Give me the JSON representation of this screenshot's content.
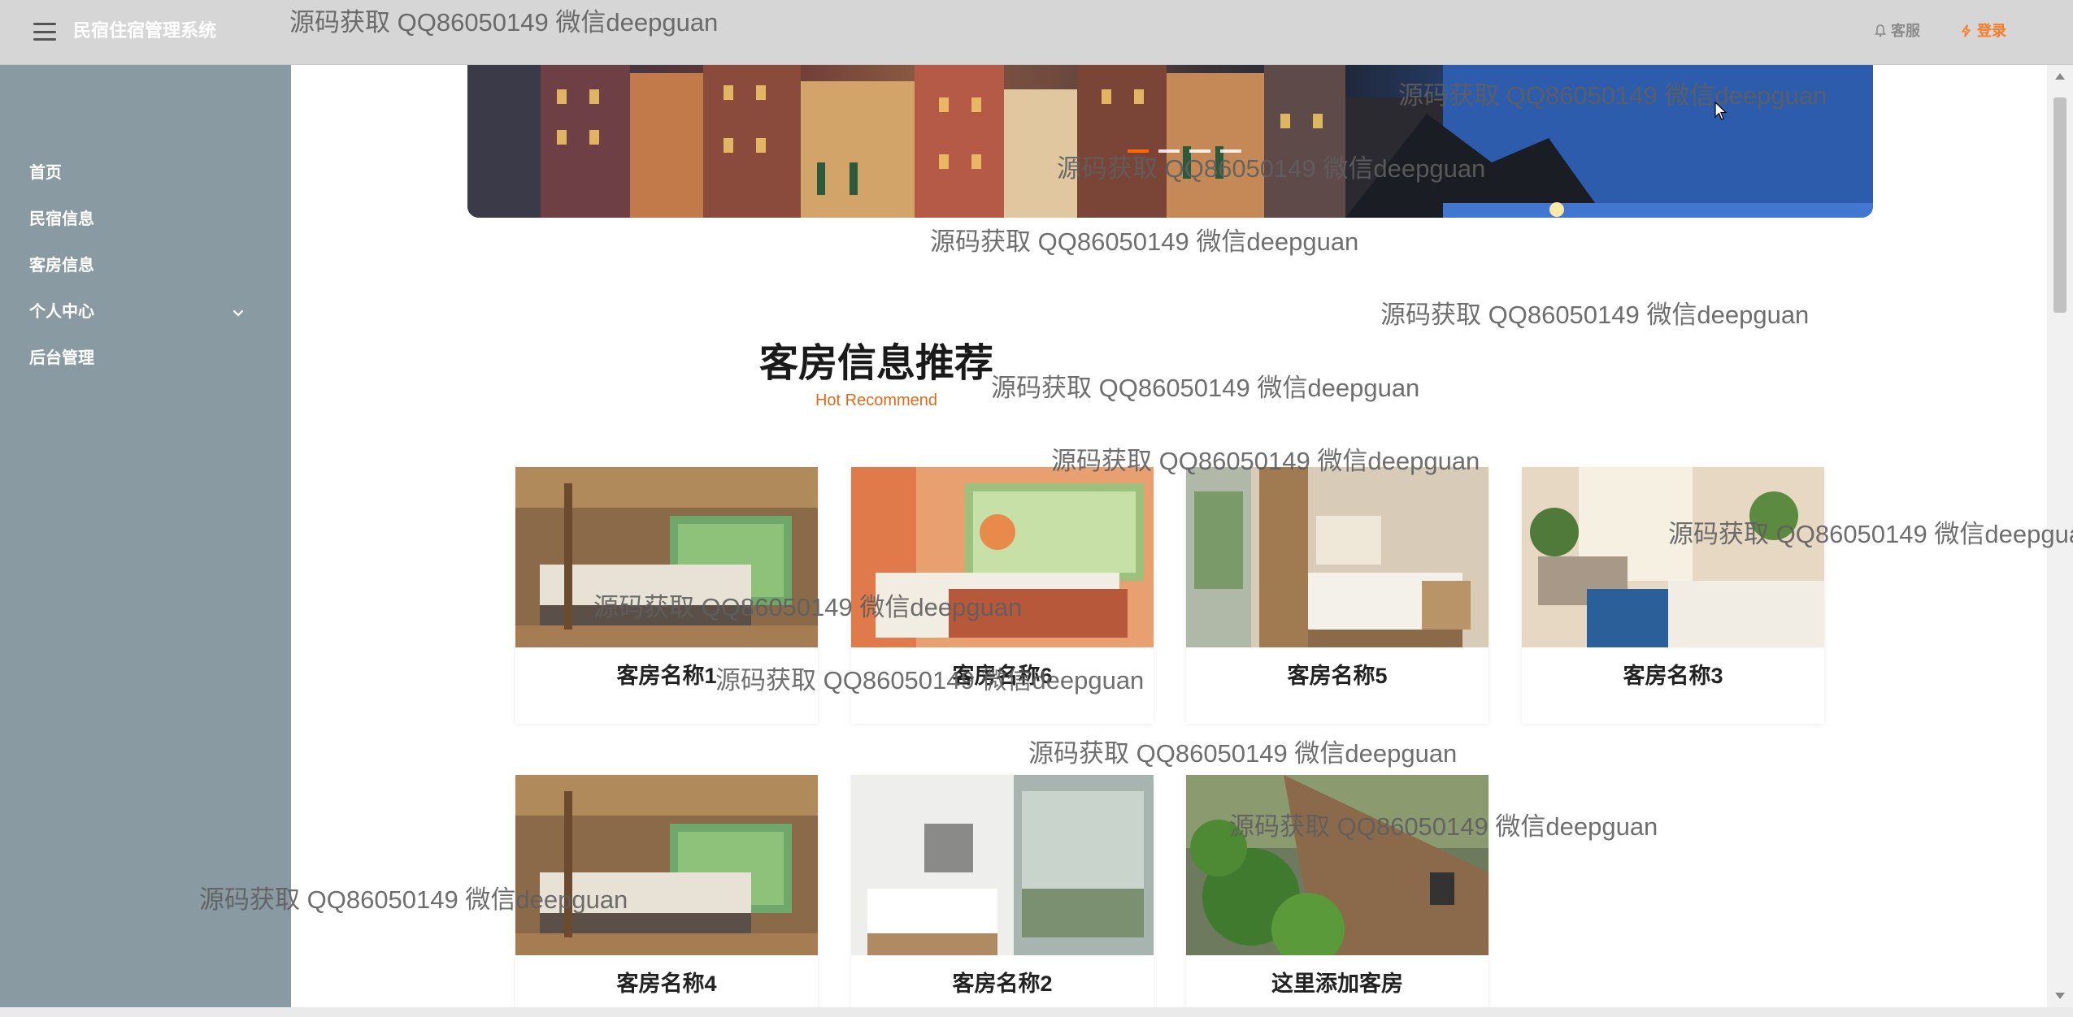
{
  "header": {
    "app_title": "民宿住宿管理系统",
    "service_label": "客服",
    "login_label": "登录"
  },
  "sidebar": {
    "items": [
      {
        "label": "首页"
      },
      {
        "label": "民宿信息"
      },
      {
        "label": "客房信息"
      },
      {
        "label": "个人中心"
      },
      {
        "label": "后台管理"
      }
    ]
  },
  "banner": {
    "slide_count": 4,
    "active_index": 0
  },
  "recommend": {
    "title": "客房信息推荐",
    "subtitle": "Hot Recommend",
    "rooms": [
      {
        "name": "客房名称1",
        "photo": "wood-loft-bedroom"
      },
      {
        "name": "客房名称6",
        "photo": "orange-wall-bedroom"
      },
      {
        "name": "客房名称5",
        "photo": "wood-slat-bedroom"
      },
      {
        "name": "客房名称3",
        "photo": "bright-plant-bedroom"
      },
      {
        "name": "客房名称4",
        "photo": "wood-loft-bedroom"
      },
      {
        "name": "客房名称2",
        "photo": "glass-wall-bedroom"
      },
      {
        "name": "这里添加客房",
        "photo": "garden-stairs"
      }
    ]
  },
  "watermark": {
    "text": "源码获取 QQ86050149 微信deepguan"
  },
  "colors": {
    "topbar": "#d6d6d6",
    "sidebar": "#8a9aa3",
    "accent": "#ff7a22",
    "subtitle": "#e06a1c"
  }
}
